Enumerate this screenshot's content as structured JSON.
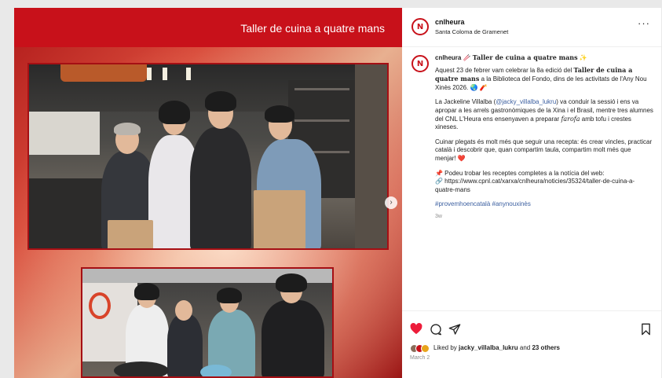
{
  "media": {
    "banner_title": "Taller de cuina a quatre mans",
    "next_label": "›"
  },
  "post": {
    "username": "cnlheura",
    "location": "Santa Coloma de Gramenet",
    "more": "···",
    "logo_text": "N"
  },
  "caption": {
    "username": "cnlheura",
    "title_emoji_left": "🥢",
    "title": "Taller de cuina a quatre mans",
    "title_emoji_right": "✨",
    "p1_a": "Aquest 23 de febrer vam celebrar la 8a edició del ",
    "p1_b": "Taller de cuina a quatre mans",
    "p1_c": " a la Biblioteca del Fondo, dins de les activitats de l'Any Nou Xinès 2026. 🌏 🧨",
    "p2_a": "La Jackeline Villalba (",
    "p2_link": "@jacky_villalba_lukru",
    "p2_b": ") va conduir la sessió i ens va apropar a les arrels gastronòmiques de la Xina i el Brasil, mentre tres alumnes del CNL L'Heura ens ensenyaven a preparar ",
    "p2_ital": "farofa",
    "p2_c": " amb tofu i crestes xineses.",
    "p3": "Cuinar plegats és molt més que seguir una recepta: és crear vincles, practicar català i descobrir que, quan compartim taula, compartim molt més que menjar! ❤️",
    "p4_a": "📌 Podeu trobar les receptes completes a la notícia del web:",
    "p4_b": "🔗 https://www.cpnl.cat/xarxa/cnlheura/noticies/35324/taller-de-cuina-a-quatre-mans",
    "hashtags": "#provemhoencatalà #anynouxinès",
    "time": "3w"
  },
  "actions": {
    "liked_by_prefix": "Liked by ",
    "liked_by_user": "jacky_villalba_lukru",
    "liked_by_mid": " and ",
    "liked_by_count": "23 others",
    "date": "March 2"
  },
  "colors": {
    "brand_red": "#c8111a",
    "like_red": "#ed1c3a",
    "link_blue": "#3b5fa0"
  },
  "icons": [
    "heart-icon",
    "comment-icon",
    "share-icon",
    "bookmark-icon",
    "more-icon",
    "chevron-right-icon"
  ]
}
